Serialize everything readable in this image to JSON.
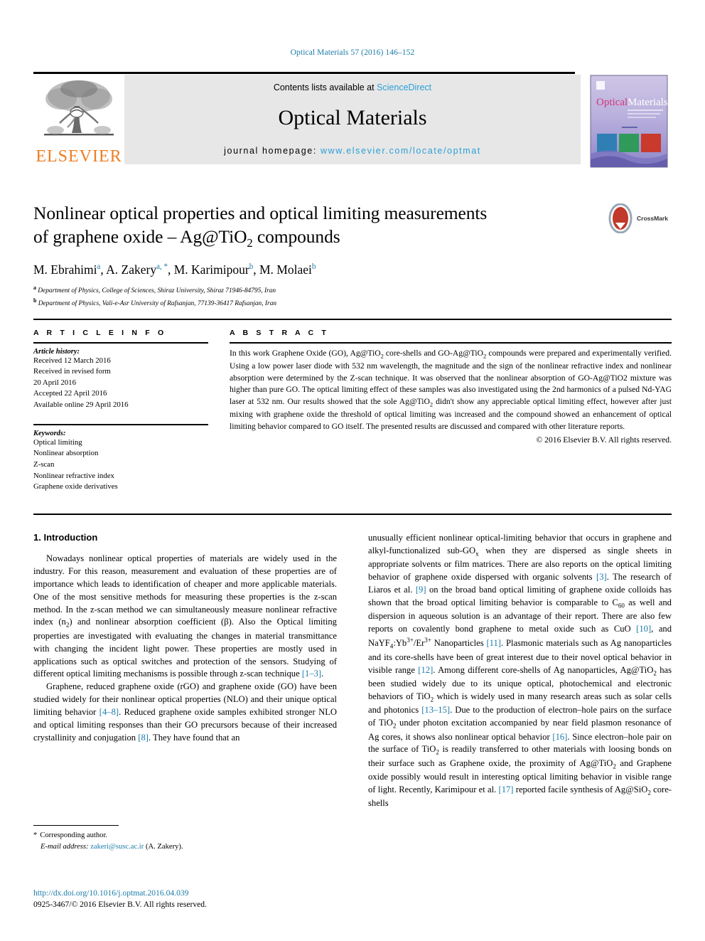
{
  "running_head": "Optical Materials 57 (2016) 146–152",
  "masthead": {
    "publisher_name": "ELSEVIER",
    "contents_prefix": "Contents lists available at ",
    "sciencedirect": "ScienceDirect",
    "journal_title": "Optical Materials",
    "homepage_prefix": "journal homepage: ",
    "homepage_url": "www.elsevier.com/locate/optmat",
    "cover_title_1": "Optical",
    "cover_title_2": "Materials"
  },
  "article": {
    "title_line_1": "Nonlinear optical properties and optical limiting measurements",
    "title_line_2_a": "of graphene oxide – Ag@TiO",
    "title_line_2_sub": "2",
    "title_line_2_b": " compounds",
    "crossmark_label": "CrossMark",
    "authors": [
      {
        "name": "M. Ebrahimi",
        "marks": "a"
      },
      {
        "name": "A. Zakery",
        "marks": "a, *"
      },
      {
        "name": "M. Karimipour",
        "marks": "b"
      },
      {
        "name": "M. Molaei",
        "marks": "b"
      }
    ],
    "affiliations": [
      {
        "mark": "a",
        "text": "Department of Physics, College of Sciences, Shiraz University, Shiraz 71946-84795, Iran"
      },
      {
        "mark": "b",
        "text": "Department of Physics, Vali-e-Asr University of Rafsanjan, 77139-36417 Rafsanjan, Iran"
      }
    ]
  },
  "article_info": {
    "heading": "A R T I C L E   I N F O",
    "history_label": "Article history:",
    "history": [
      "Received 12 March 2016",
      "Received in revised form",
      "20 April 2016",
      "Accepted 22 April 2016",
      "Available online 29 April 2016"
    ],
    "keywords_label": "Keywords:",
    "keywords": [
      "Optical limiting",
      "Nonlinear absorption",
      "Z-scan",
      "Nonlinear refractive index",
      "Graphene oxide derivatives"
    ]
  },
  "abstract": {
    "heading": "A B S T R A C T",
    "p1_a": "In this work Graphene Oxide (GO), Ag@TiO",
    "p1_sub1": "2",
    "p1_b": " core-shells and GO-Ag@TiO",
    "p1_sub2": "2",
    "p1_c": " compounds were prepared and experimentally verified. Using a low power laser diode with 532 nm wavelength, the magnitude and the sign of the nonlinear refractive index and nonlinear absorption were determined by the Z-scan technique. It was observed that the nonlinear absorption of GO-Ag@TiO2 mixture was higher than pure GO. The optical limiting effect of these samples was also investigated using the 2nd harmonics of a pulsed Nd-YAG laser at 532 nm. Our results showed that the sole Ag@TiO",
    "p1_sub3": "2",
    "p1_d": " didn't show any appreciable optical limiting effect, however after just mixing with graphene oxide the threshold of optical limiting was increased and the compound showed an enhancement of optical limiting behavior compared to GO itself. The presented results are discussed and compared with other literature reports.",
    "copyright": "© 2016 Elsevier B.V. All rights reserved."
  },
  "introduction": {
    "heading": "1. Introduction",
    "left_p1": "Nowadays nonlinear optical properties of materials are widely used in the industry. For this reason, measurement and evaluation of these properties are of importance which leads to identification of cheaper and more applicable materials. One of the most sensitive methods for measuring these properties is the z-scan method. In the z-scan method we can simultaneously measure nonlinear refractive index (n",
    "left_p1_sub1": "2",
    "left_p1_b": ") and nonlinear absorption coefficient (β). Also the Optical limiting properties are investigated with evaluating the changes in material transmittance with changing the incident light power. These properties are mostly used in applications such as optical switches and protection of the sensors. Studying of different optical limiting mechanisms is possible through z-scan technique ",
    "left_p1_ref": "[1–3]",
    "left_p1_end": ".",
    "left_p2_a": "Graphene, reduced graphene oxide (rGO) and graphene oxide (GO) have been studied widely for their nonlinear optical properties (NLO) and their unique optical limiting behavior ",
    "left_p2_ref1": "[4–8]",
    "left_p2_b": ". Reduced graphene oxide samples exhibited stronger NLO and optical limiting responses than their GO precursors because of their increased crystallinity and conjugation ",
    "left_p2_ref2": "[8]",
    "left_p2_c": ". They have found that an",
    "right_a": "unusually efficient nonlinear optical-limiting behavior that occurs in graphene and alkyl-functionalized sub-GO",
    "right_sub1": "x",
    "right_b": " when they are dispersed as single sheets in appropriate solvents or film matrices. There are also reports on the optical limiting behavior of graphene oxide dispersed with organic solvents ",
    "right_ref1": "[3]",
    "right_c": ". The research of Liaros et al. ",
    "right_ref2": "[9]",
    "right_d": " on the broad band optical limiting of graphene oxide colloids has shown that the broad optical limiting behavior is comparable to C",
    "right_sub2": "60",
    "right_e": " as well and dispersion in aqueous solution is an advantage of their report. There are also few reports on covalently bond graphene to metal oxide such as CuO ",
    "right_ref3": "[10]",
    "right_f": ", and NaYF",
    "right_sub3": "4",
    "right_g": ":Yb",
    "right_sup1": "3+",
    "right_h": "/Er",
    "right_sup2": "3+",
    "right_i": " Nanoparticles ",
    "right_ref4": "[11]",
    "right_j": ". Plasmonic materials such as Ag nanoparticles and its core-shells have been of great interest due to their novel optical behavior in visible range ",
    "right_ref5": "[12]",
    "right_k": ". Among different core-shells of Ag nanoparticles, Ag@TiO",
    "right_sub4": "2",
    "right_l": " has been studied widely due to its unique optical, photochemical and electronic behaviors of TiO",
    "right_sub5": "2",
    "right_m": " which is widely used in many research areas such as solar cells and photonics ",
    "right_ref6": "[13–15]",
    "right_n": ". Due to the production of electron–hole pairs on the surface of TiO",
    "right_sub6": "2",
    "right_o": " under photon excitation accompanied by near field plasmon resonance of Ag cores, it shows also nonlinear optical behavior ",
    "right_ref7": "[16]",
    "right_p": ". Since electron–hole pair on the surface of TiO",
    "right_sub7": "2",
    "right_q": " is readily transferred to other materials with loosing bonds on their surface such as Graphene oxide, the proximity of Ag@TiO",
    "right_sub8": "2",
    "right_r": " and Graphene oxide possibly would result in interesting optical limiting behavior in visible range of light. Recently, Karimipour et al. ",
    "right_ref8": "[17]",
    "right_s": " reported facile synthesis of Ag@SiO",
    "right_sub9": "2",
    "right_t": " core-shells"
  },
  "footnote": {
    "corresponding": "Corresponding author.",
    "email_label": "E-mail address:",
    "email": "zakeri@susc.ac.ir",
    "email_owner": "(A. Zakery)."
  },
  "footer": {
    "doi": "http://dx.doi.org/10.1016/j.optmat.2016.04.039",
    "issn": "0925-3467/© 2016 Elsevier B.V. All rights reserved."
  },
  "colors": {
    "link": "#1a7ba8",
    "sciencedirect": "#2a9fd6",
    "elsevier_orange": "#ef7d22"
  }
}
